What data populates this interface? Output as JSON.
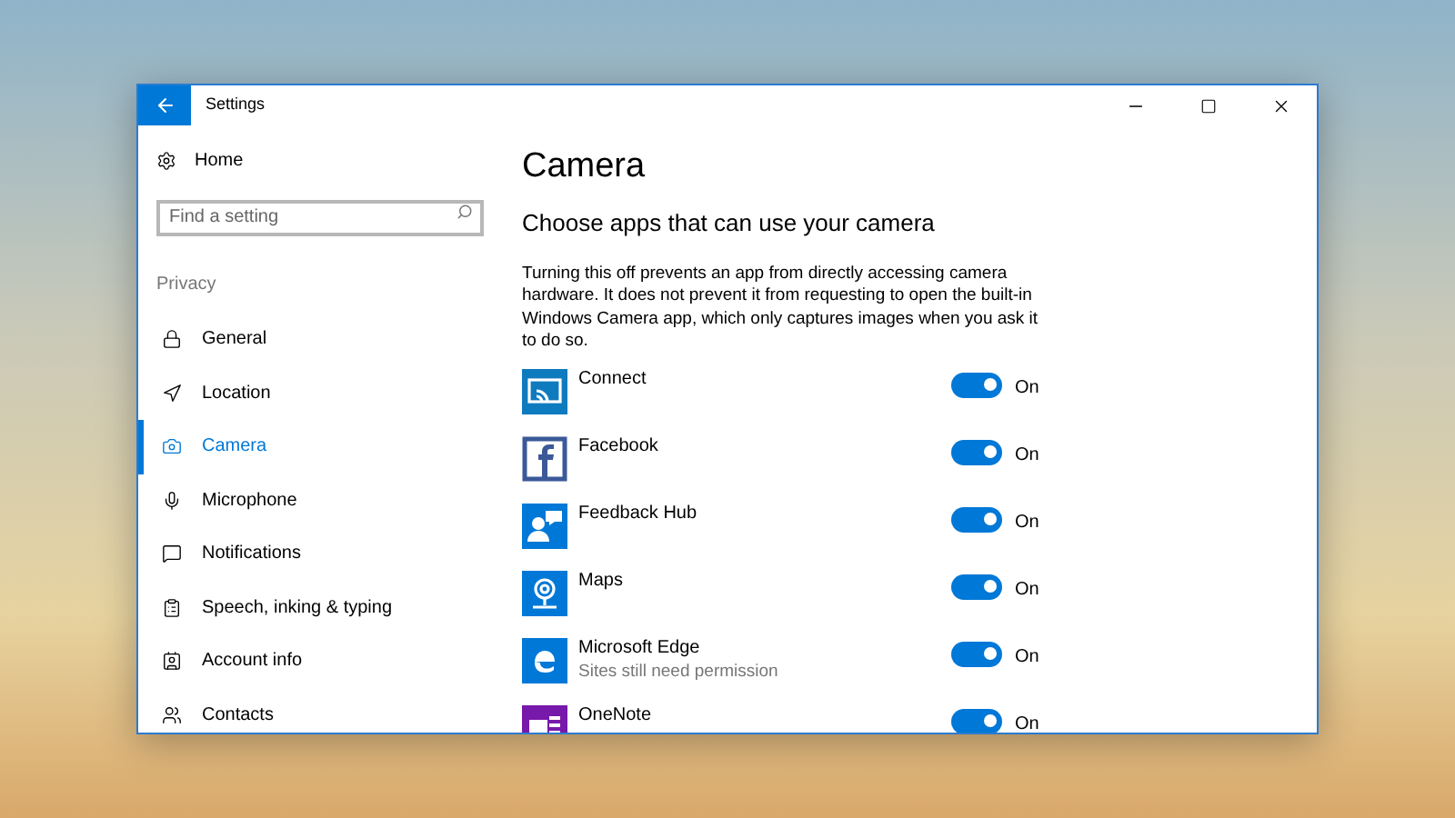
{
  "window": {
    "title": "Settings"
  },
  "sidebar": {
    "home": "Home",
    "search": {
      "placeholder": "Find a setting"
    },
    "section": "Privacy",
    "items": [
      {
        "label": "General",
        "kind": "lock",
        "selected": false
      },
      {
        "label": "Location",
        "kind": "location",
        "selected": false
      },
      {
        "label": "Camera",
        "kind": "camera",
        "selected": true
      },
      {
        "label": "Microphone",
        "kind": "mic",
        "selected": false
      },
      {
        "label": "Notifications",
        "kind": "chat",
        "selected": false
      },
      {
        "label": "Speech, inking & typing",
        "kind": "clipboard",
        "selected": false
      },
      {
        "label": "Account info",
        "kind": "account",
        "selected": false
      },
      {
        "label": "Contacts",
        "kind": "contacts",
        "selected": false
      }
    ]
  },
  "page": {
    "title": "Camera",
    "subtitle": "Choose apps that can use your camera",
    "description": "Turning this off prevents an app from directly accessing camera hardware. It does not prevent it from requesting to open the built-in Windows Camera app, which only captures images when you ask it to do so.",
    "apps": [
      {
        "name": "Connect",
        "kind": "connect",
        "color": "#0f7bbf",
        "on": true,
        "state": "On"
      },
      {
        "name": "Facebook",
        "kind": "facebook",
        "color": "#3b5998",
        "on": true,
        "state": "On"
      },
      {
        "name": "Feedback Hub",
        "kind": "feedback",
        "color": "#0078d7",
        "on": true,
        "state": "On"
      },
      {
        "name": "Maps",
        "kind": "maps",
        "color": "#0078d7",
        "on": true,
        "state": "On"
      },
      {
        "name": "Microsoft Edge",
        "kind": "edge",
        "color": "#0078d7",
        "on": true,
        "state": "On",
        "note": "Sites still need permission"
      },
      {
        "name": "OneNote",
        "kind": "onenote",
        "color": "#7719aa",
        "on": true,
        "state": "On"
      }
    ]
  }
}
